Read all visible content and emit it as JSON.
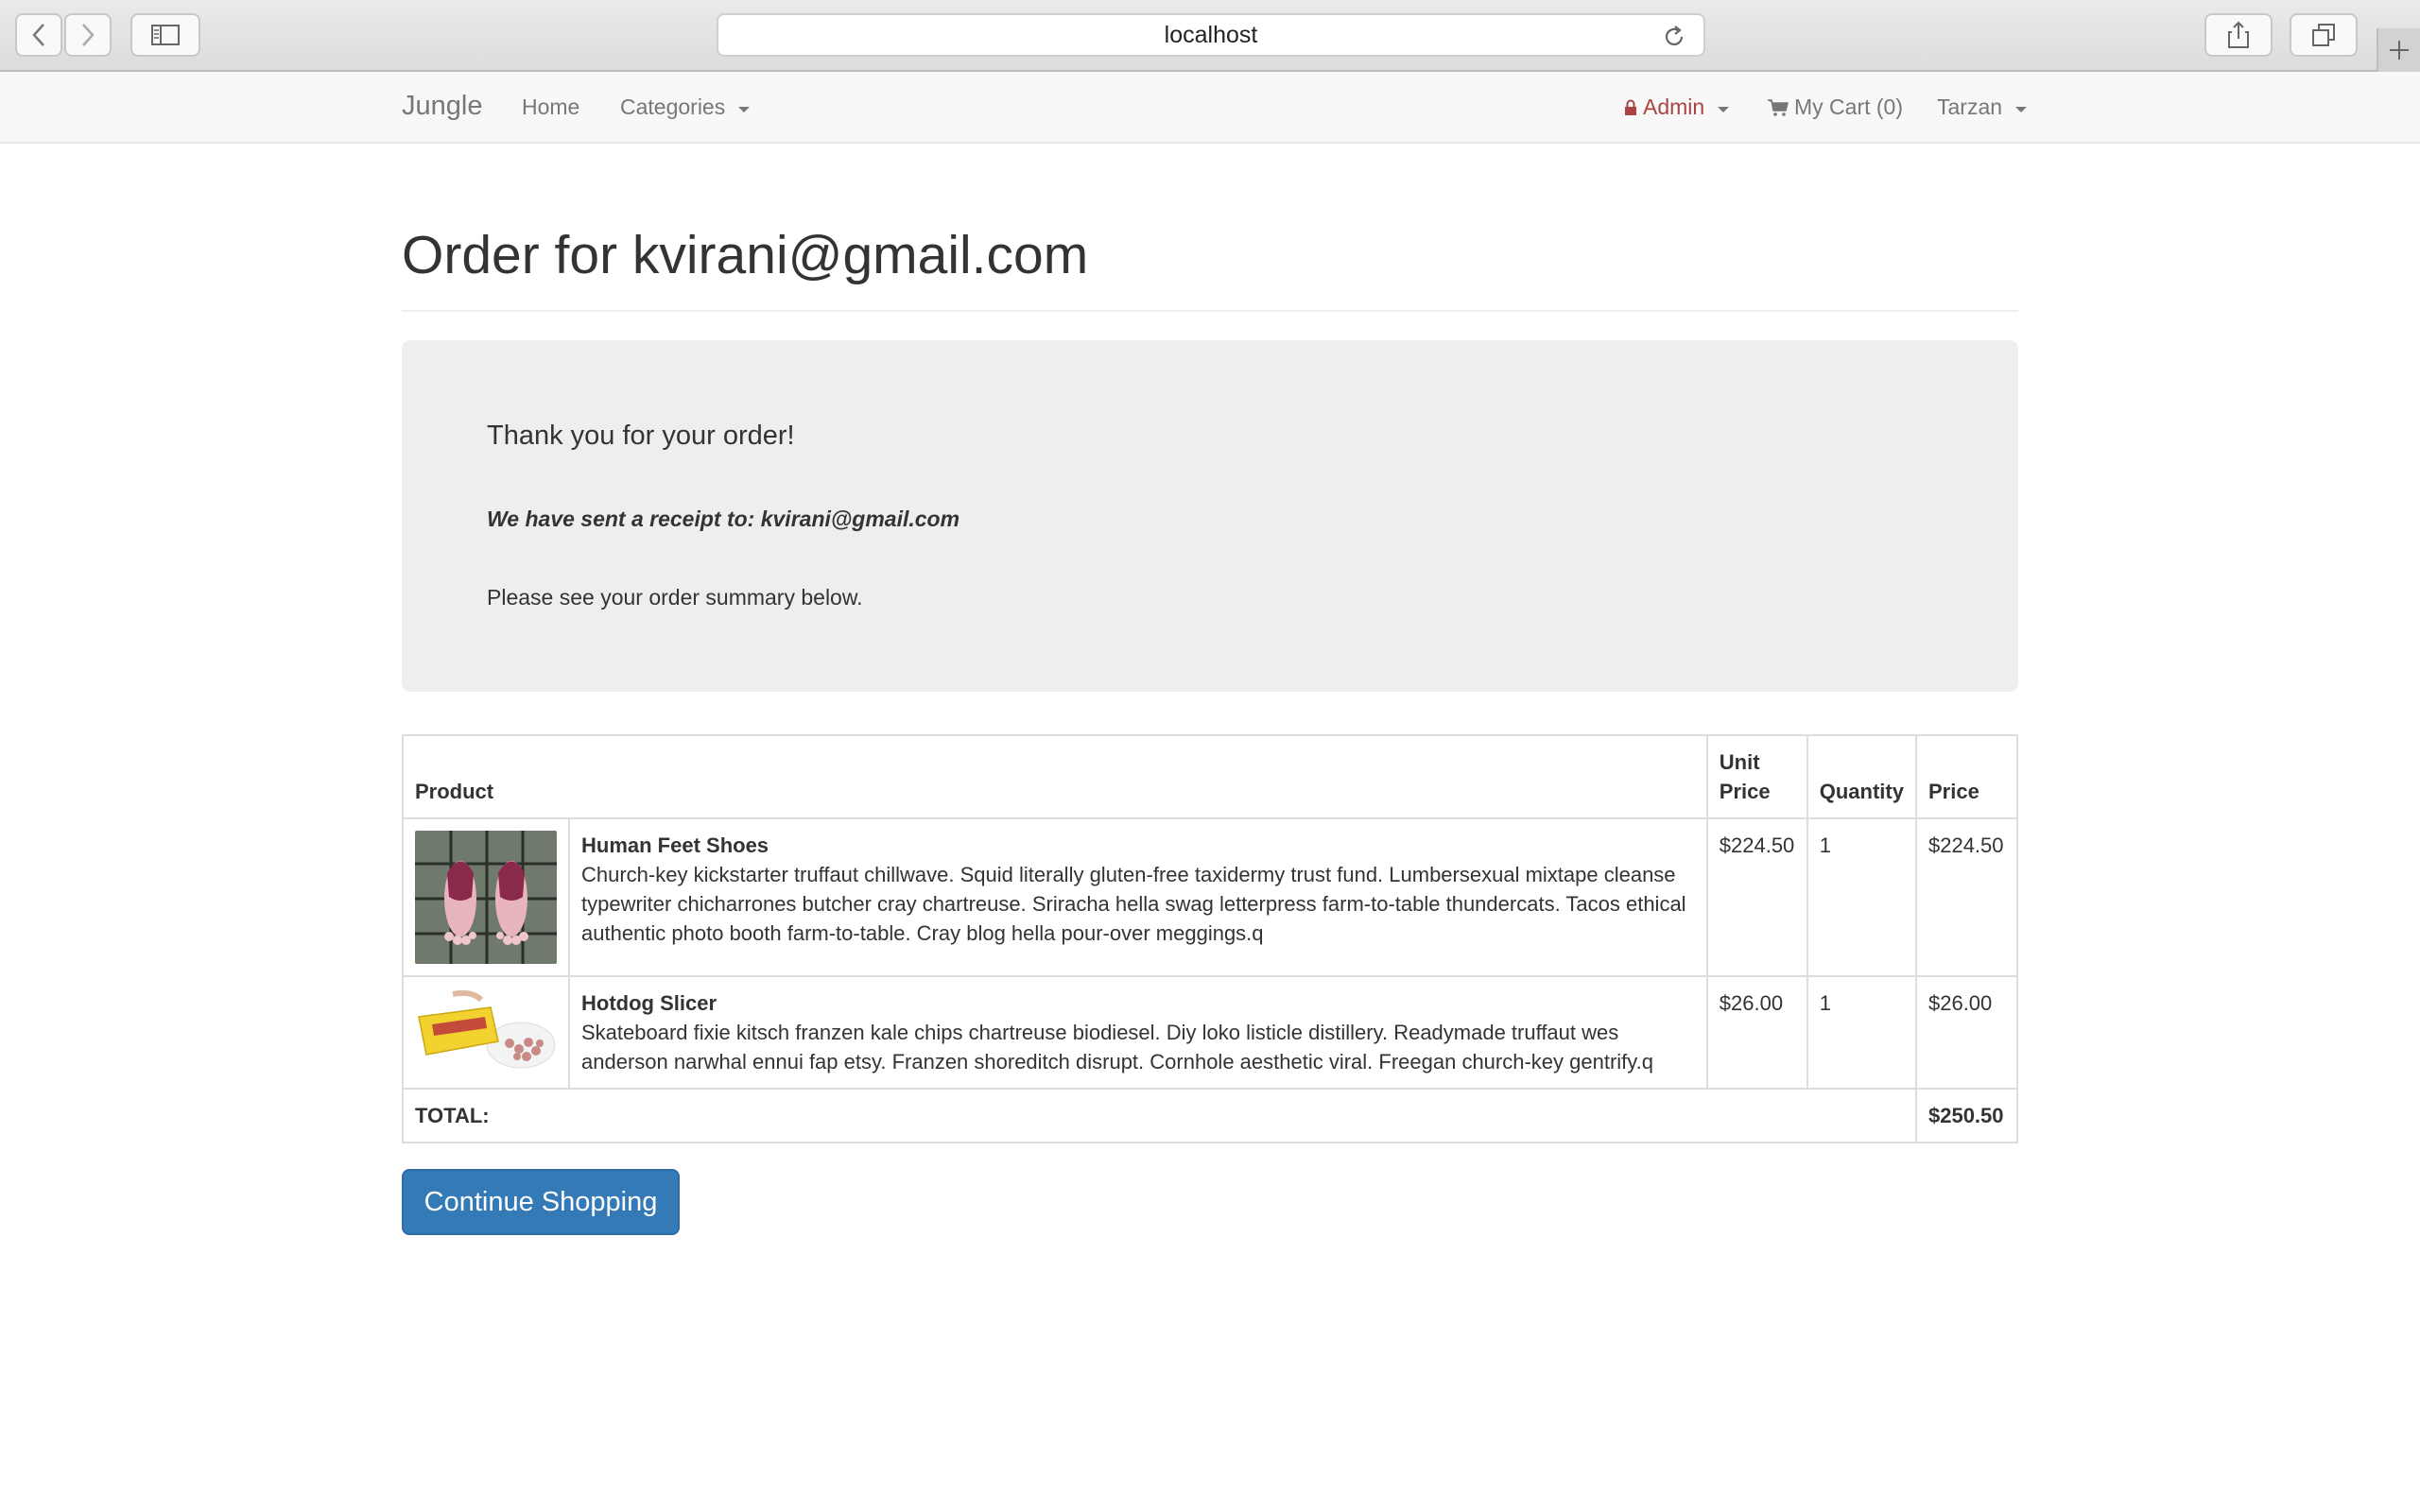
{
  "browser": {
    "url": "localhost"
  },
  "navbar": {
    "brand": "Jungle",
    "home": "Home",
    "categories": "Categories",
    "admin": "Admin",
    "cart": "My Cart (0)",
    "user": "Tarzan"
  },
  "page": {
    "title": "Order for kvirani@gmail.com"
  },
  "jumbotron": {
    "thanks": "Thank you for your order!",
    "receipt": "We have sent a receipt to: kvirani@gmail.com",
    "summary": "Please see your order summary below."
  },
  "table": {
    "headers": {
      "product": "Product",
      "unit_price": "Unit Price",
      "quantity": "Quantity",
      "price": "Price"
    },
    "rows": [
      {
        "name": "Human Feet Shoes",
        "description": "Church-key kickstarter truffaut chillwave. Squid literally gluten-free taxidermy trust fund. Lumbersexual mixtape cleanse typewriter chicharrones butcher cray chartreuse. Sriracha hella swag letterpress farm-to-table thundercats. Tacos ethical authentic photo booth farm-to-table. Cray blog hella pour-over meggings.q",
        "unit_price": "$224.50",
        "quantity": "1",
        "price": "$224.50"
      },
      {
        "name": "Hotdog Slicer",
        "description": "Skateboard fixie kitsch franzen kale chips chartreuse biodiesel. Diy loko listicle distillery. Readymade truffaut wes anderson narwhal ennui fap etsy. Franzen shoreditch disrupt. Cornhole aesthetic viral. Freegan church-key gentrify.q",
        "unit_price": "$26.00",
        "quantity": "1",
        "price": "$26.00"
      }
    ],
    "total_label": "TOTAL:",
    "total_value": "$250.50"
  },
  "actions": {
    "continue": "Continue Shopping"
  },
  "colors": {
    "primary": "#337ab7",
    "admin": "#a94442",
    "jumbotron": "#eeeeee"
  }
}
